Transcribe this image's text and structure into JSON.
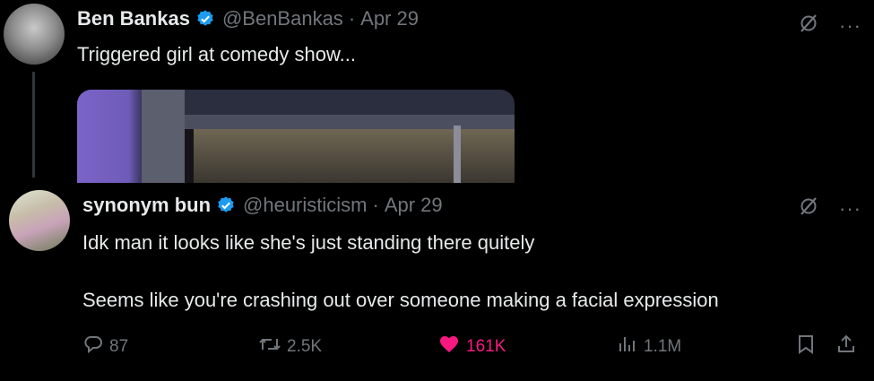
{
  "tweet": {
    "author": "Ben Bankas",
    "handle": "@BenBankas",
    "separator": "·",
    "date": "Apr 29",
    "text": "Triggered girl at comedy show..."
  },
  "reply": {
    "author": "synonym bun",
    "handle": "@heuristicism",
    "separator": "·",
    "date": "Apr 29",
    "line1": "Idk man it looks like she's just standing there quitely",
    "line2": "Seems like you're crashing out over someone making a facial expression",
    "metrics": {
      "replies": "87",
      "reposts": "2.5K",
      "likes": "161K",
      "views": "1.1M"
    }
  },
  "icons": {
    "verified": "verified-badge-icon",
    "grok": "grok-icon",
    "more": "more-icon",
    "reply": "reply-icon",
    "repost": "repost-icon",
    "like": "heart-icon",
    "views": "views-icon",
    "bookmark": "bookmark-icon",
    "share": "share-icon"
  },
  "colors": {
    "background": "#000000",
    "text": "#e7e9ea",
    "muted": "#71767b",
    "verified": "#1d9bf0",
    "like": "#f91880"
  },
  "more_label": "···"
}
